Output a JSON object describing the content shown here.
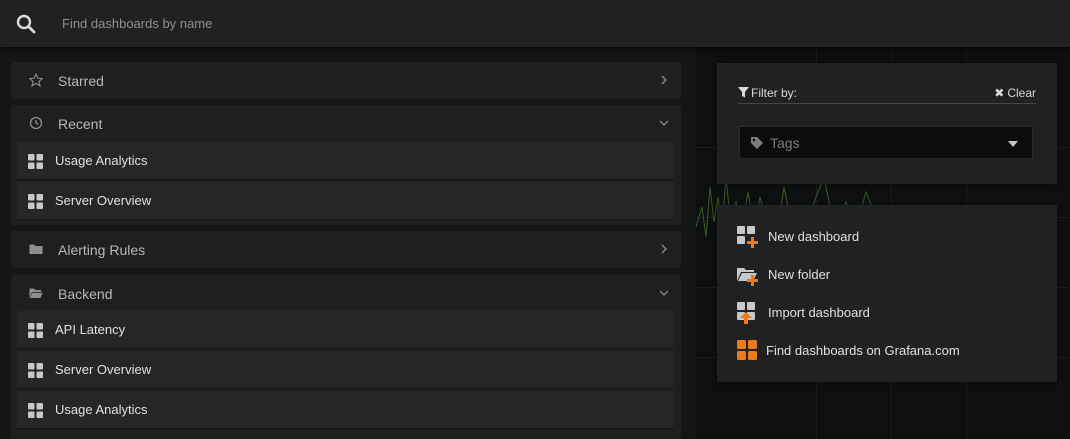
{
  "search": {
    "placeholder": "Find dashboards by name"
  },
  "sections": [
    {
      "title": "Starred",
      "icon": "star-icon",
      "expanded": false,
      "items": []
    },
    {
      "title": "Recent",
      "icon": "clock-icon",
      "expanded": true,
      "items": [
        "Usage Analytics",
        "Server Overview"
      ]
    },
    {
      "title": "Alerting Rules",
      "icon": "folder-icon",
      "expanded": false,
      "items": []
    },
    {
      "title": "Backend",
      "icon": "folder-open-icon",
      "expanded": true,
      "items": [
        "API Latency",
        "Server Overview",
        "Usage Analytics"
      ]
    }
  ],
  "filter": {
    "label": "Filter by:",
    "clear_label": "Clear",
    "tags_placeholder": "Tags"
  },
  "actions": [
    {
      "label": "New dashboard",
      "icon": "new-dashboard-icon"
    },
    {
      "label": "New folder",
      "icon": "new-folder-icon"
    },
    {
      "label": "Import dashboard",
      "icon": "import-dashboard-icon"
    },
    {
      "label": "Find dashboards on Grafana.com",
      "icon": "grafana-com-icon"
    }
  ],
  "colors": {
    "accent_orange": "#eb7b18",
    "panel_bg": "#202123",
    "item_bg": "#262628"
  }
}
